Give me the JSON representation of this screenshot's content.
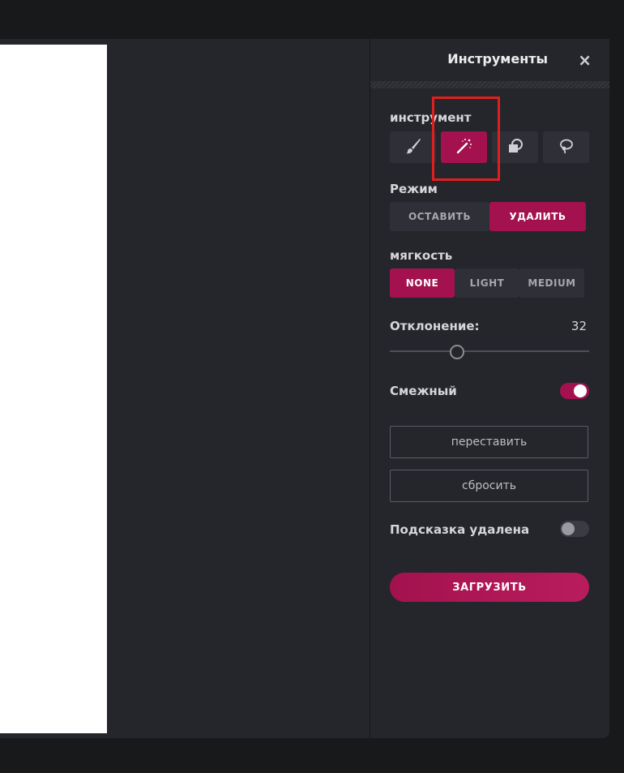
{
  "panel": {
    "title": "Инструменты",
    "close_icon": "×"
  },
  "tool": {
    "label": "инструмент",
    "items": [
      {
        "name": "brush-icon",
        "active": false
      },
      {
        "name": "magic-wand-icon",
        "active": true
      },
      {
        "name": "shape-icon",
        "active": false
      },
      {
        "name": "lasso-icon",
        "active": false
      }
    ]
  },
  "mode": {
    "label": "Режим",
    "options": [
      "ОСТАВИТЬ",
      "УДАЛИТЬ"
    ],
    "selected": "УДАЛИТЬ"
  },
  "softness": {
    "label": "мягкость",
    "options": [
      "NONE",
      "LIGHT",
      "MEDIUM"
    ],
    "selected": "NONE"
  },
  "deviation": {
    "label": "Отклонение:",
    "value": "32"
  },
  "contiguous": {
    "label": "Смежный",
    "on": true
  },
  "buttons": {
    "rearrange": "переставить",
    "reset": "сбросить",
    "upload": "ЗАГРУЗИТЬ"
  },
  "hint": {
    "label": "Подсказка удалена",
    "on": false
  },
  "colors": {
    "accent": "#a3124e",
    "panel_bg": "#25262c",
    "highlight": "#e01f1f"
  }
}
